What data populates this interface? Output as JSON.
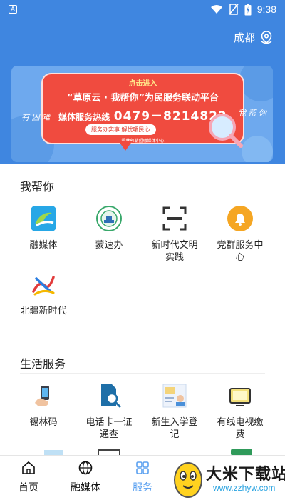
{
  "status_bar": {
    "time": "9:38",
    "app_badge": "A"
  },
  "header": {
    "location": "成都"
  },
  "banner": {
    "cta": "点击进入",
    "title": "“草原云 · 我帮你”为民服务联动平台",
    "hotline_label": "媒体服务热线",
    "hotline_number": "0479－8214822",
    "slogan": "服务办实事  解忧暖民心",
    "org": "锡林郭勒盟融媒体中心",
    "side_left": "有 困 难",
    "side_right": "我 帮 你"
  },
  "sections": {
    "help": {
      "title": "我帮你",
      "items": [
        {
          "label": "融媒体",
          "icon": "media-fusion-icon"
        },
        {
          "label": "蒙速办",
          "icon": "mengsuban-icon"
        },
        {
          "label": "新时代文明实践",
          "icon": "scan-frame-icon"
        },
        {
          "label": "党群服务中心",
          "icon": "bell-icon"
        },
        {
          "label": "北疆新时代",
          "icon": "beijiang-logo-icon"
        }
      ]
    },
    "life": {
      "title": "生活服务",
      "items": [
        {
          "label": "锡林码",
          "icon": "hand-phone-icon"
        },
        {
          "label": "电话卡一证通查",
          "icon": "simcard-search-icon"
        },
        {
          "label": "新生入学登记",
          "icon": "enrollment-icon"
        },
        {
          "label": "有线电视缴费",
          "icon": "cable-tv-icon"
        }
      ]
    }
  },
  "tabbar": {
    "tabs": [
      {
        "label": "首页",
        "icon": "home-icon"
      },
      {
        "label": "融媒体",
        "icon": "globe-icon"
      },
      {
        "label": "服务",
        "icon": "grid-icon"
      }
    ]
  },
  "watermark": {
    "title": "大米下载站",
    "url": "www.zzhyw.com"
  },
  "colors": {
    "header_blue": "#3f86e0",
    "banner_red": "#f04b3f",
    "tab_active": "#5aa0f0"
  }
}
